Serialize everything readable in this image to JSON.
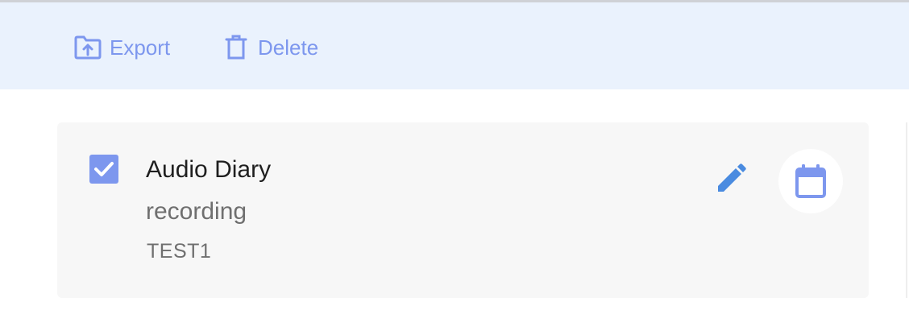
{
  "toolbar": {
    "export_label": "Export",
    "delete_label": "Delete",
    "export_icon": "folder-upload-icon",
    "delete_icon": "trash-icon"
  },
  "item": {
    "checked": true,
    "title": "Audio Diary",
    "subtitle": "recording",
    "code": "TEST1",
    "edit_icon": "pencil-icon",
    "calendar_icon": "calendar-icon"
  },
  "colors": {
    "accent": "#7d97ee",
    "edit_blue": "#4a8be0",
    "toolbar_bg": "#eaf2fd",
    "card_bg": "#f7f7f7"
  }
}
